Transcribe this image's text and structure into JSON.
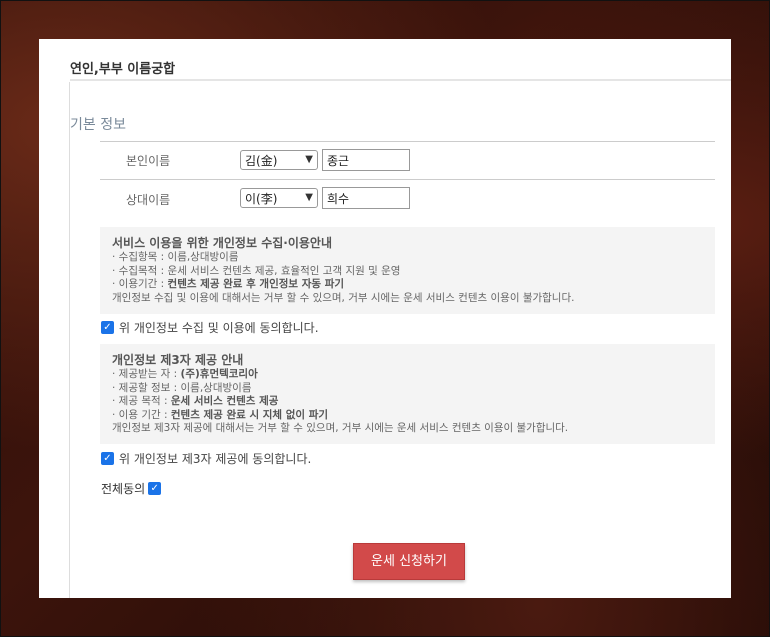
{
  "panel": {
    "title": "연인,부부 이름궁합"
  },
  "basic": {
    "section_title": "기본 정보",
    "self": {
      "label": "본인이름",
      "surname": "김(金)",
      "name": "종근"
    },
    "partner": {
      "label": "상대이름",
      "surname": "이(李)",
      "name": "희수"
    }
  },
  "privacy": {
    "title": "서비스 이용을 위한 개인정보 수집·이용안내",
    "line1": "· 수집항목 : 이름,상대방이름",
    "line2": "· 수집목적 : 운세 서비스 컨텐츠 제공, 효율적인 고객 지원 및 운영",
    "line3_prefix": "· 이용기간 : ",
    "line3_bold": "컨텐츠 제공 완료 후 개인정보 자동 파기",
    "line4": "개인정보 수집 및 이용에 대해서는 거부 할 수 있으며, 거부 시에는 운세 서비스 컨텐츠 이용이 불가합니다.",
    "agree_label": "위 개인정보 수집 및 이용에 동의합니다."
  },
  "third": {
    "title": "개인정보 제3자 제공 안내",
    "line1_prefix": "· 제공받는 자 : ",
    "line1_bold": "(주)휴먼텍코리아",
    "line2": "· 제공할 정보 : 이름,상대방이름",
    "line3_prefix": "· 제공 목적 : ",
    "line3_bold": "운세 서비스 컨텐츠 제공",
    "line4_prefix": "· 이용 기간 : ",
    "line4_bold": "컨텐츠 제공 완료 시 지체 없이 파기",
    "line5": "개인정보 제3자 제공에 대해서는 거부 할 수 있으며, 거부 시에는 운세 서비스 컨텐츠 이용이 불가합니다.",
    "agree_label": "위 개인정보 제3자 제공에 동의합니다."
  },
  "all_agree": {
    "label": "전체동의"
  },
  "submit": {
    "label": "운세 신청하기"
  },
  "colors": {
    "accent": "#d24a4a",
    "checkbox": "#1a73e8"
  }
}
